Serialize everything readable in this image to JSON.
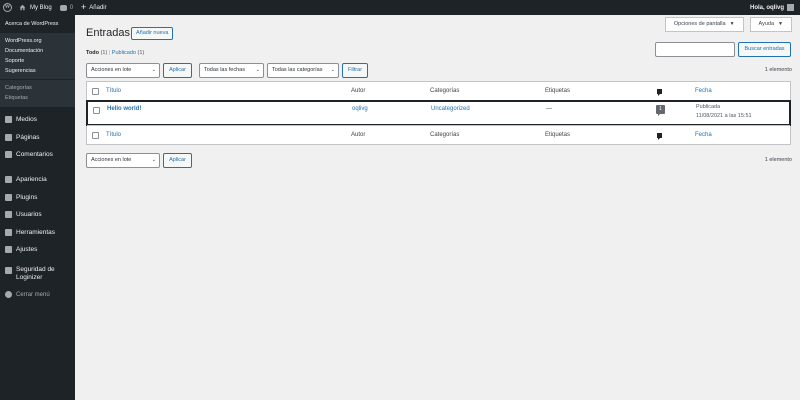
{
  "adminbar": {
    "site_name": "My Blog",
    "comments_count": "0",
    "new_label": "Añadir",
    "greeting": "Hola, oqlivg"
  },
  "sidebar": {
    "about": "Acerca de WordPress",
    "links": [
      "WordPress.org",
      "Documentación",
      "Soporte",
      "Sugerencias"
    ],
    "submenu": [
      "Categorías",
      "Etiquetas"
    ],
    "menu": [
      "Medios",
      "Páginas",
      "Comentarios",
      "Apariencia",
      "Plugins",
      "Usuarios",
      "Herramientas",
      "Ajustes"
    ],
    "security_line1": "Seguridad de",
    "security_line2": "Loginizer",
    "collapse": "Cerrar menú"
  },
  "header": {
    "title": "Entradas",
    "add_new": "Añadir nueva",
    "screen_options": "Opciones de pantalla",
    "help": "Ayuda"
  },
  "filters": {
    "all_label": "Todo",
    "all_count": "(1)",
    "published_label": "Publicado",
    "published_count": "(1)",
    "search_button": "Buscar entradas",
    "bulk_actions": "Acciones en lote",
    "apply": "Aplicar",
    "all_dates": "Todas las fechas",
    "all_categories": "Todas las categorías",
    "filter": "Filtrar",
    "items_count": "1 elemento"
  },
  "table": {
    "columns": {
      "title": "Título",
      "author": "Autor",
      "categories": "Categorías",
      "tags": "Etiquetas",
      "date": "Fecha"
    },
    "rows": [
      {
        "title": "Hello world!",
        "author": "oqlivg",
        "category": "Uncategorized",
        "tags": "—",
        "comments": "1",
        "status": "Publicada",
        "date": "11/08/2021 a las 15:51"
      }
    ]
  }
}
